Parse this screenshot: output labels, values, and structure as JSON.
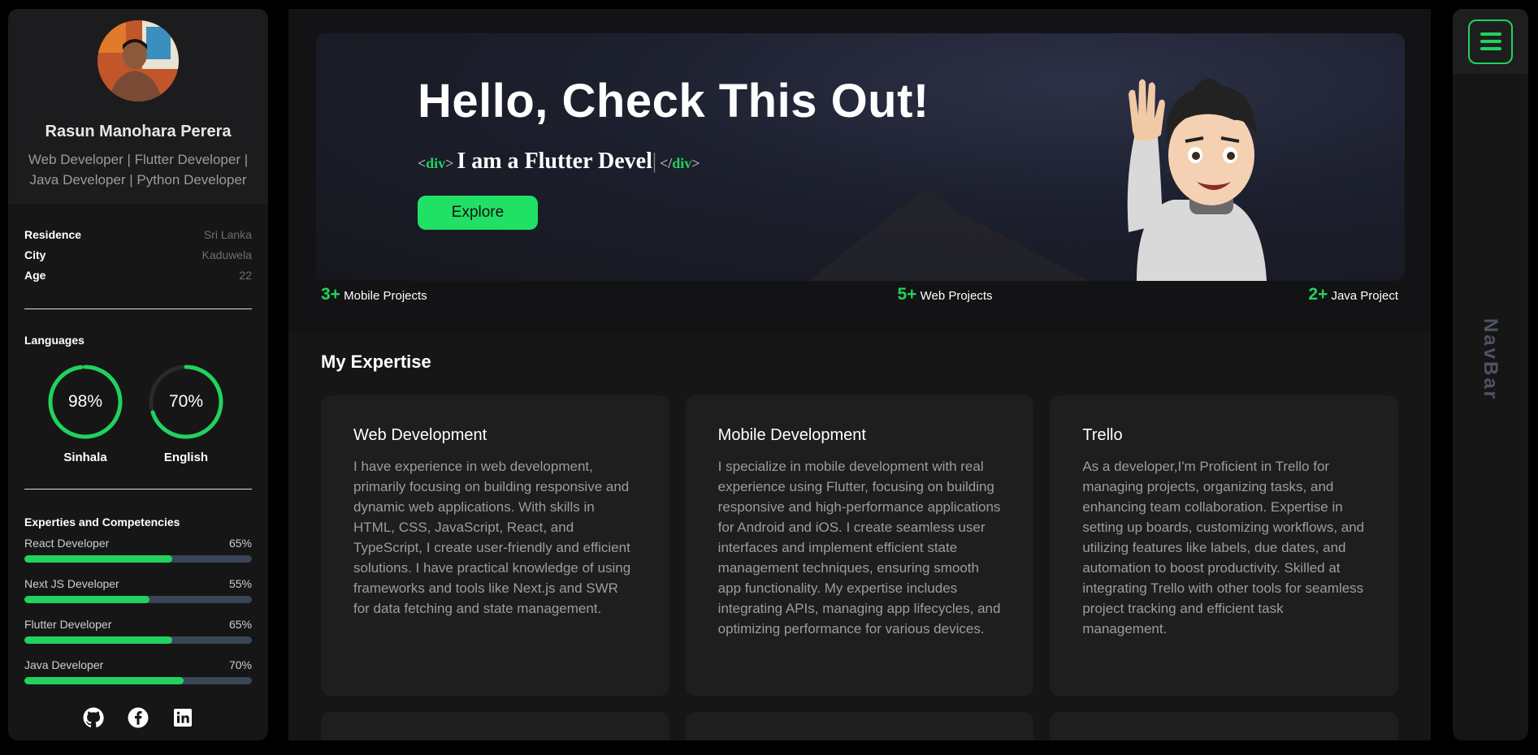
{
  "profile": {
    "name": "Rasun Manohara Perera",
    "role_line1": "Web Developer | Flutter Developer |",
    "role_line2": "Java Developer | Python Developer"
  },
  "info": [
    {
      "key": "Residence",
      "value": "Sri Lanka"
    },
    {
      "key": "City",
      "value": "Kaduwela"
    },
    {
      "key": "Age",
      "value": "22"
    }
  ],
  "languages": {
    "title": "Languages",
    "items": [
      {
        "name": "Sinhala",
        "percent_label": "98%",
        "percent": 98
      },
      {
        "name": "English",
        "percent_label": "70%",
        "percent": 70
      }
    ]
  },
  "skills": {
    "title": "Experties and Competencies",
    "items": [
      {
        "name": "React Developer",
        "percent_label": "65%",
        "percent": 65
      },
      {
        "name": "Next JS Developer",
        "percent_label": "55%",
        "percent": 55
      },
      {
        "name": "Flutter Developer",
        "percent_label": "65%",
        "percent": 65
      },
      {
        "name": "Java Developer",
        "percent_label": "70%",
        "percent": 70
      }
    ]
  },
  "social": [
    "github-icon",
    "facebook-icon",
    "linkedin-icon"
  ],
  "hero": {
    "title": "Hello, Check This Out!",
    "tag_open_lt": "<",
    "tag_name": "div",
    "tag_gt": ">",
    "typing_text": "I am a Flutter Devel",
    "cursor": "|",
    "tag_close_lt": "</",
    "explore_label": "Explore"
  },
  "stats": [
    {
      "number": "3+",
      "label": "Mobile Projects"
    },
    {
      "number": "5+",
      "label": "Web Projects"
    },
    {
      "number": "2+",
      "label": "Java Project"
    }
  ],
  "expertise": {
    "title": "My Expertise",
    "cards": [
      {
        "title": "Web Development",
        "text": "I have experience in web development, primarily focusing on building responsive and dynamic web applications. With skills in HTML, CSS, JavaScript, React, and TypeScript, I create user-friendly and efficient solutions. I have practical knowledge of using frameworks and tools like Next.js and SWR for data fetching and state management."
      },
      {
        "title": "Mobile Development",
        "text": "I specialize in mobile development with real experience using Flutter, focusing on building responsive and high-performance applications for Android and iOS. I create seamless user interfaces and implement efficient state management techniques, ensuring smooth app functionality. My expertise includes integrating APIs, managing app lifecycles, and optimizing performance for various devices."
      },
      {
        "title": "Trello",
        "text": "As a developer,I'm Proficient in Trello for managing projects, organizing tasks, and enhancing team collaboration. Expertise in setting up boards, customizing workflows, and utilizing features like labels, due dates, and automation to boost productivity. Skilled at integrating Trello with other tools for seamless project tracking and efficient task management."
      }
    ]
  },
  "navbar": {
    "label": "NavBar"
  },
  "colors": {
    "accent": "#21d25e",
    "background": "#000000",
    "panel": "#161616",
    "card": "#1e1e1e"
  }
}
